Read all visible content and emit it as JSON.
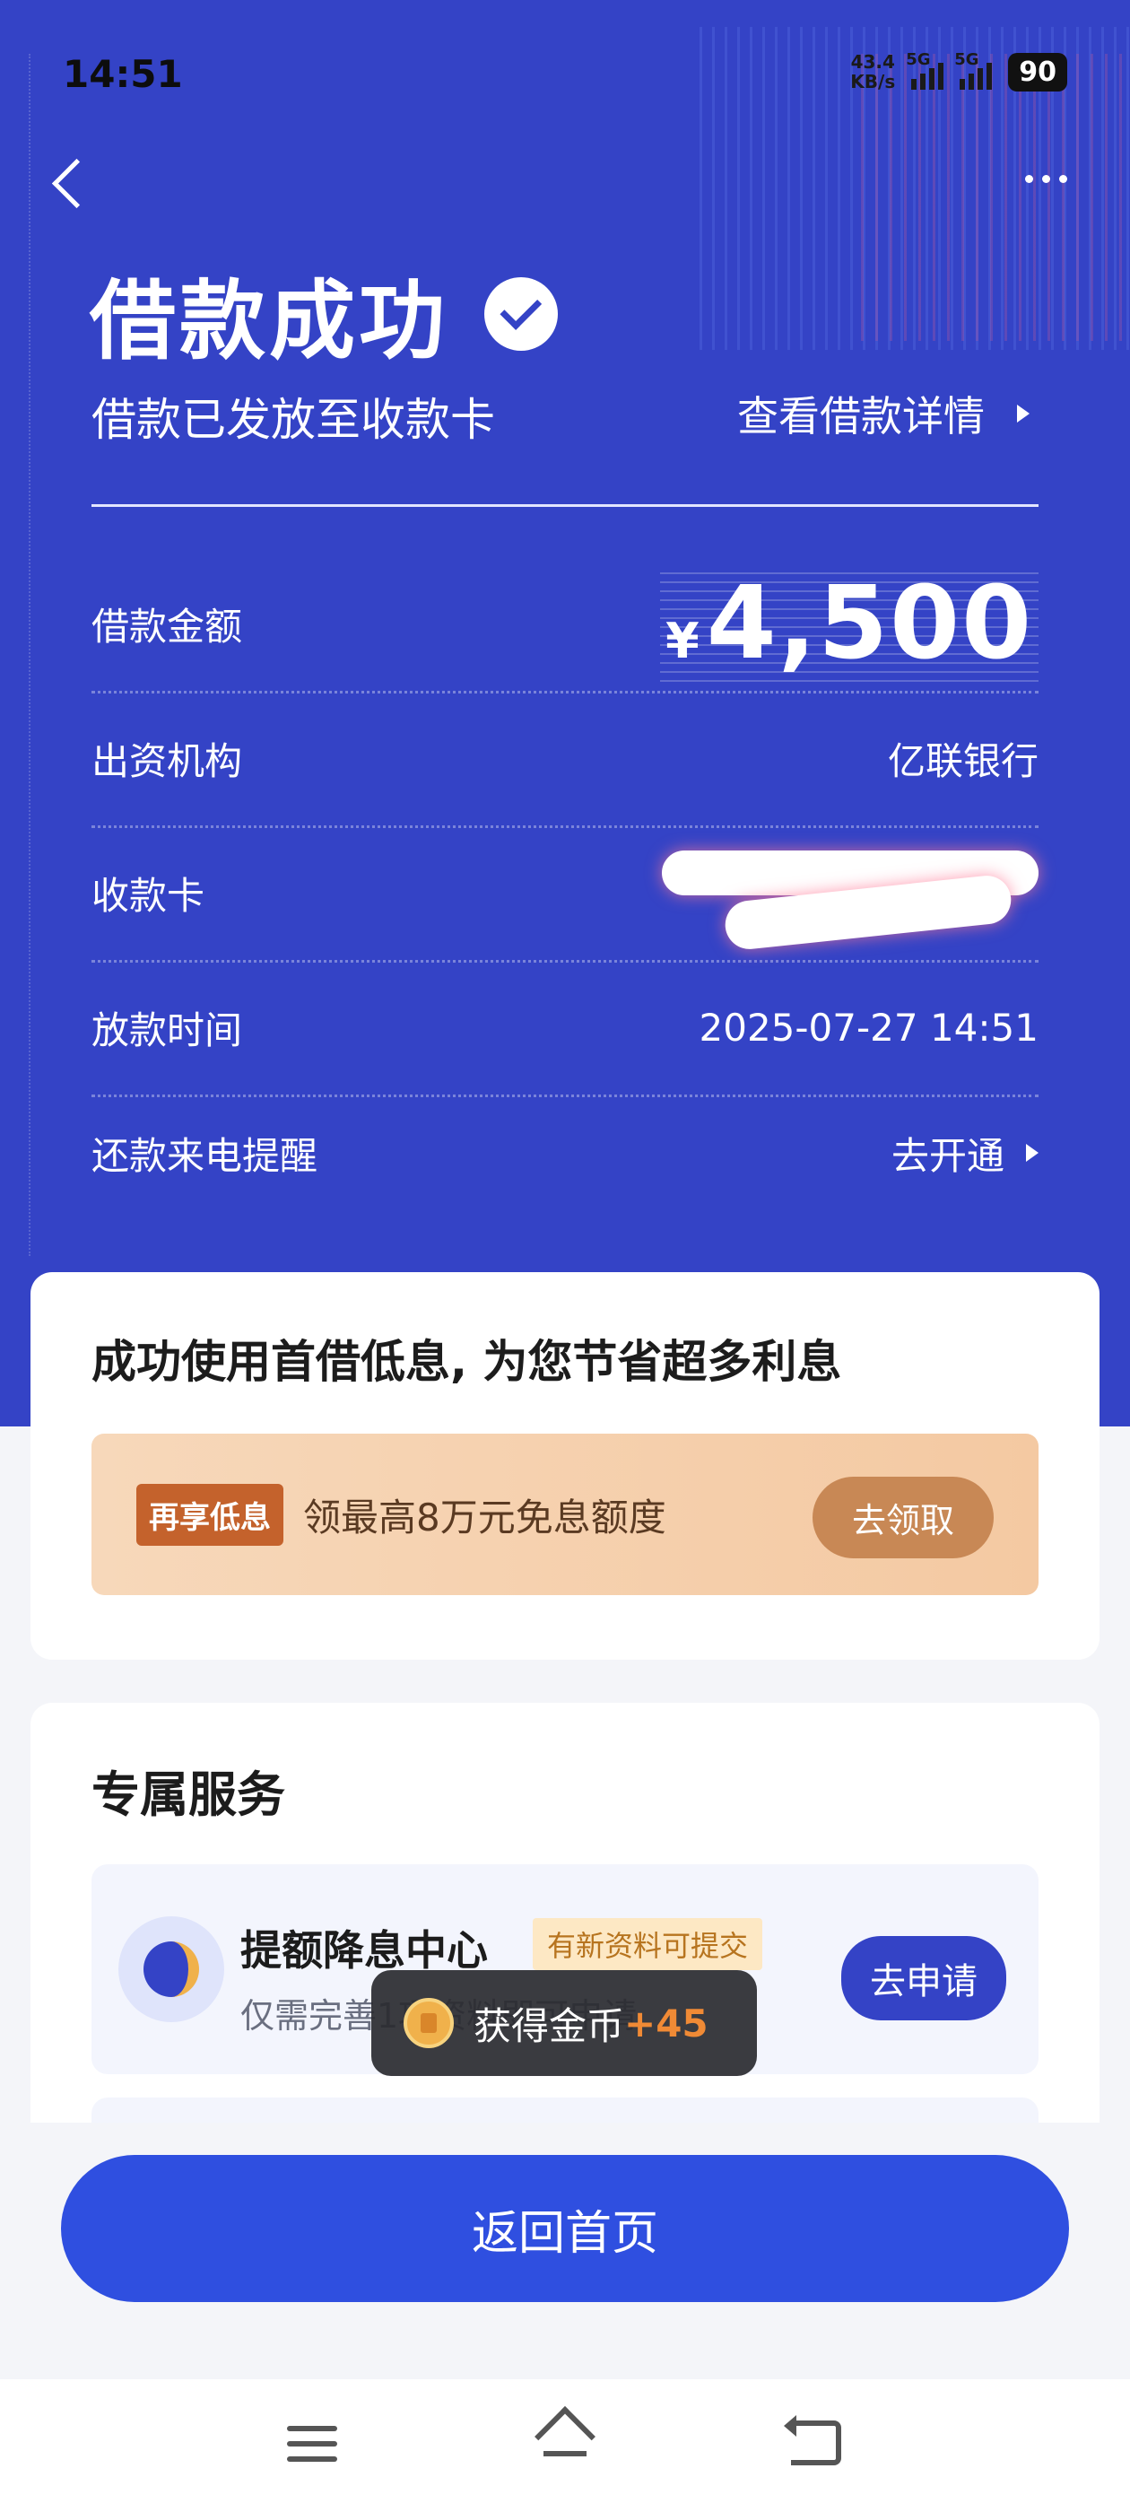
{
  "status_bar": {
    "time": "14:51",
    "net_speed_value": "43.4",
    "net_speed_unit": "KB/s",
    "signal1_label": "5G",
    "signal2_label": "5G",
    "battery": "90"
  },
  "header": {
    "title": "借款成功",
    "subtitle": "借款已发放至收款卡",
    "detail_link": "查看借款详情"
  },
  "details": {
    "amount_label": "借款金额",
    "amount_currency": "¥",
    "amount_value": "4,500",
    "funder_label": "出资机构",
    "funder_value": "亿联银行",
    "card_label": "收款卡",
    "time_label": "放款时间",
    "time_value": "2025-07-27 14:51",
    "reminder_label": "还款来电提醒",
    "reminder_action": "去开通"
  },
  "promo": {
    "title": "成功使用首借低息, 为您节省超多利息",
    "badge": "再享低息",
    "text": "领最高8万元免息额度",
    "button": "去领取"
  },
  "services": {
    "title": "专属服务",
    "item_name": "提额降息中心",
    "item_tag": "有新资料可提交",
    "item_desc": "仅需完善1项资料即可申请",
    "item_button": "去申请"
  },
  "toast": {
    "text": "获得金币",
    "plus": "+45"
  },
  "footer": {
    "home_button": "返回首页"
  },
  "colors": {
    "hero_bg": "#3443c6",
    "primary_button": "#2f4fe0",
    "promo_badge": "#c4622c",
    "coin_accent": "#f08a35"
  }
}
